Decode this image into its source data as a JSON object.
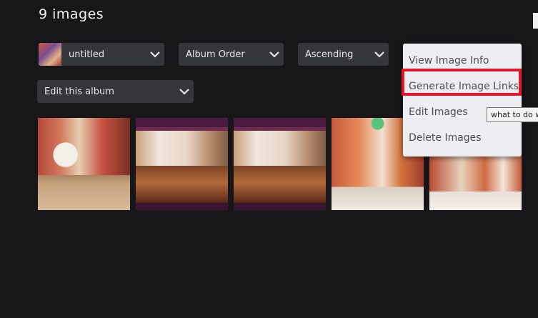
{
  "page_title": "9 images",
  "controls": {
    "album_select": "untitled",
    "order_select": "Album Order",
    "direction_select": "Ascending",
    "edit_album_select": "Edit this album"
  },
  "actions_menu": {
    "items": [
      {
        "label": "View Image Info"
      },
      {
        "label": "Generate Image Links"
      },
      {
        "label": "Edit Images"
      },
      {
        "label": "Delete Images"
      }
    ],
    "highlighted_item": "Generate Image Links",
    "highlight_color": "#e5172b"
  },
  "tooltip": "what to do w",
  "thumbnails": [
    {
      "index": 1
    },
    {
      "index": 2
    },
    {
      "index": 3
    },
    {
      "index": 4
    },
    {
      "index": 5
    }
  ],
  "colors": {
    "background": "#17171a",
    "control_bg": "#34363b",
    "menu_bg": "#eceef1"
  }
}
